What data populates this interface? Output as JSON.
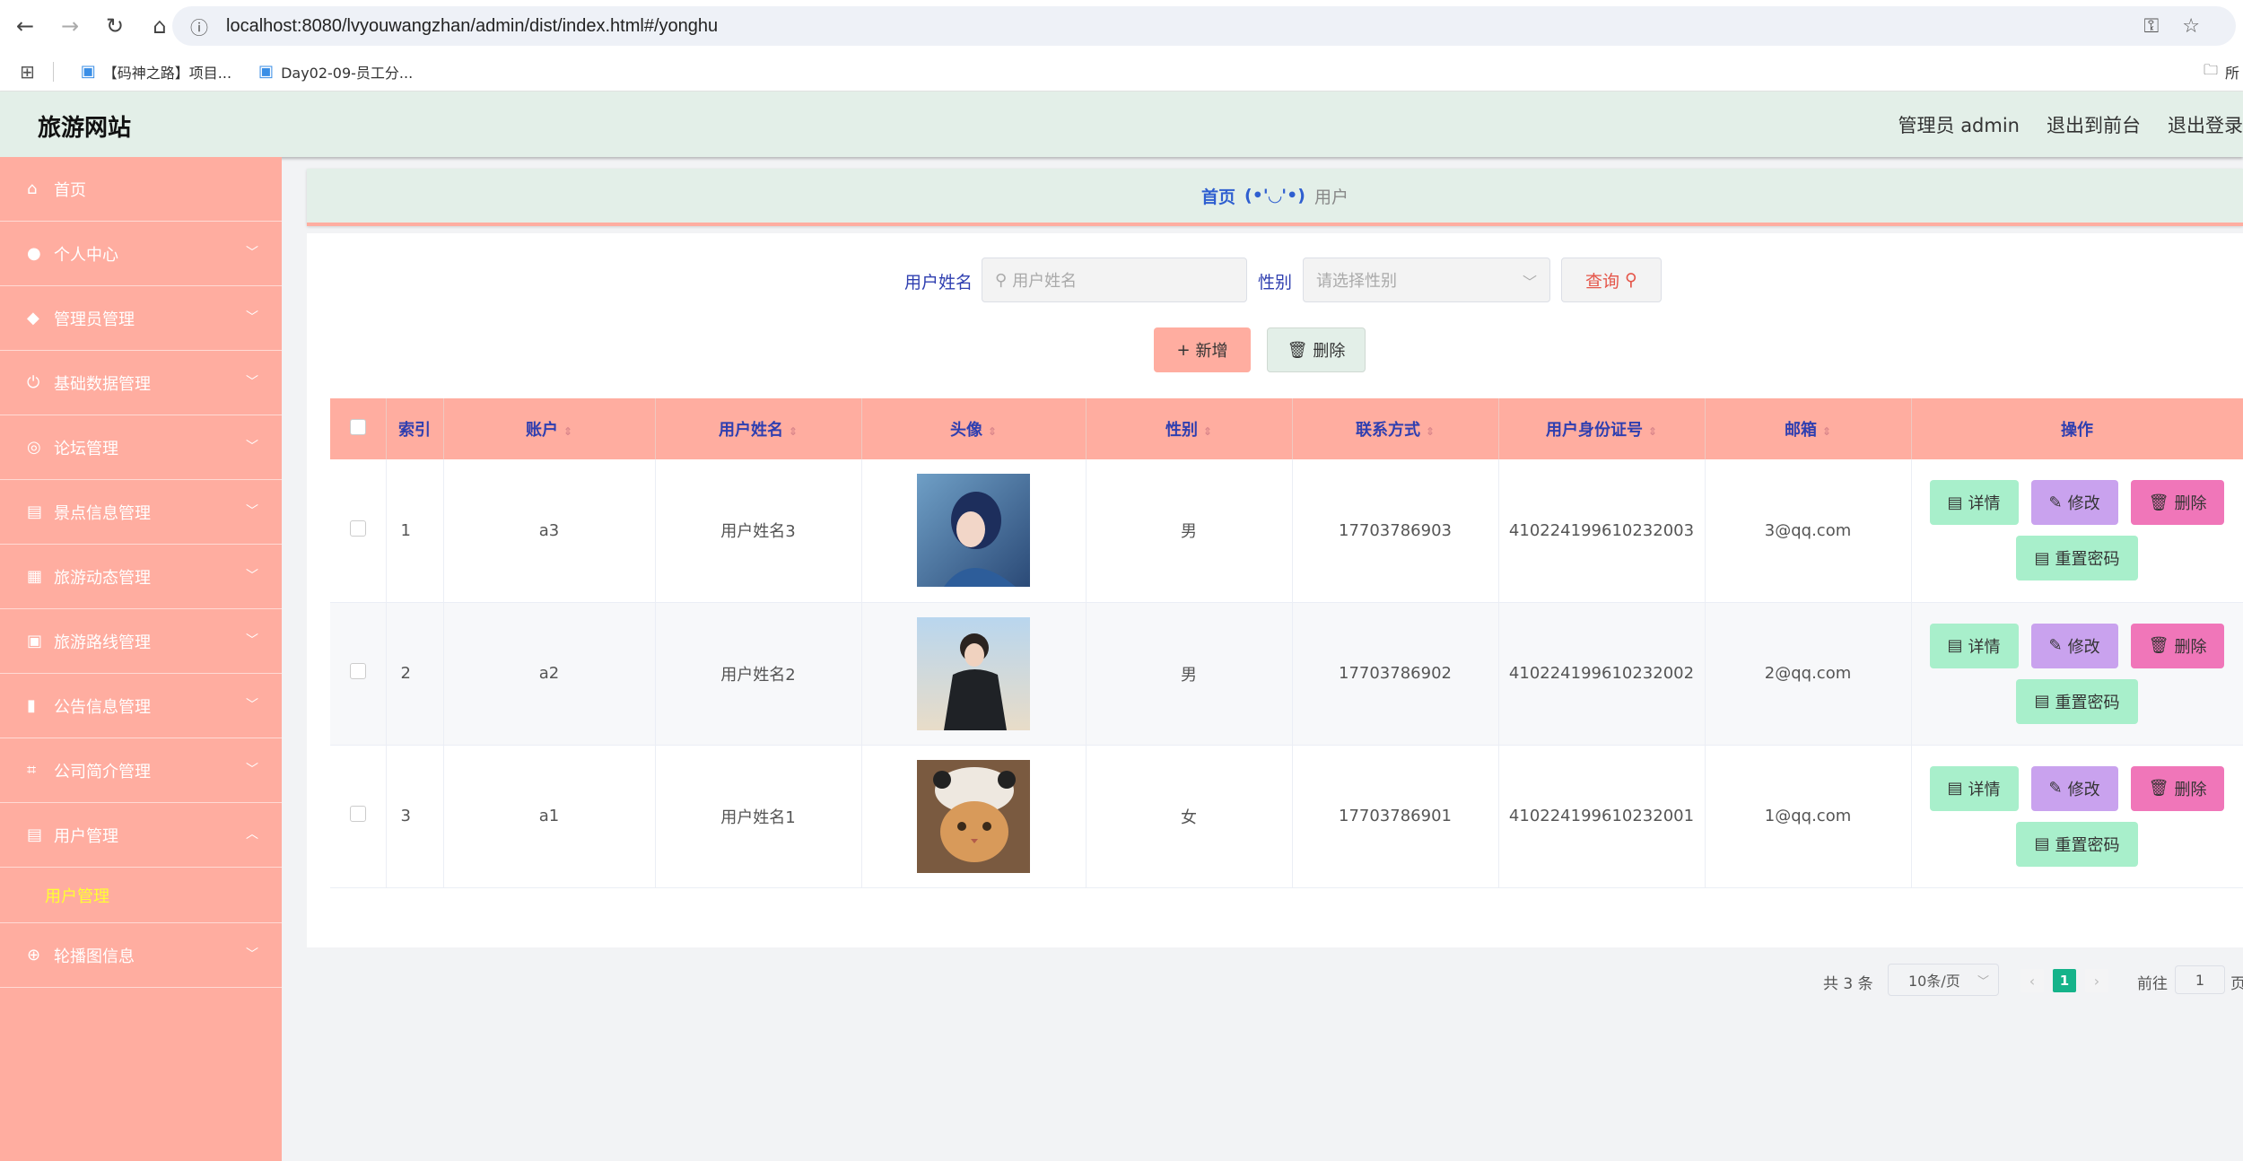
{
  "browser": {
    "url": "localhost:8080/lvyouwangzhan/admin/dist/index.html#/yonghu",
    "bookmarks": [
      "【码神之路】项目...",
      "Day02-09-员工分..."
    ],
    "bookmarks_right": "所"
  },
  "header": {
    "title": "旅游网站",
    "user": "管理员 admin",
    "to_front": "退出到前台",
    "logout": "退出登录"
  },
  "sidebar": {
    "items": [
      {
        "label": "首页",
        "icon": "home-icon"
      },
      {
        "label": "个人中心",
        "icon": "user-icon"
      },
      {
        "label": "管理员管理",
        "icon": "location-icon"
      },
      {
        "label": "基础数据管理",
        "icon": "power-icon"
      },
      {
        "label": "论坛管理",
        "icon": "compass-icon"
      },
      {
        "label": "景点信息管理",
        "icon": "document-icon"
      },
      {
        "label": "旅游动态管理",
        "icon": "grid-icon"
      },
      {
        "label": "旅游路线管理",
        "icon": "clipboard-icon"
      },
      {
        "label": "公告信息管理",
        "icon": "chart-icon"
      },
      {
        "label": "公司简介管理",
        "icon": "crop-icon"
      },
      {
        "label": "用户管理",
        "icon": "document-icon"
      },
      {
        "label": "轮播图信息",
        "icon": "basketball-icon"
      }
    ],
    "submenu": "用户管理"
  },
  "breadcrumb": {
    "home": "首页",
    "face": "(•'◡'•)",
    "current": "用户"
  },
  "search": {
    "name_label": "用户姓名",
    "name_placeholder": "用户姓名",
    "sex_label": "性别",
    "sex_placeholder": "请选择性别",
    "query_label": "查询"
  },
  "actions": {
    "add_label": "新增",
    "delete_label": "删除"
  },
  "table": {
    "headers": [
      "索引",
      "账户",
      "用户姓名",
      "头像",
      "性别",
      "联系方式",
      "用户身份证号",
      "邮箱",
      "操作"
    ],
    "rows": [
      {
        "index": "1",
        "account": "a3",
        "name": "用户姓名3",
        "sex": "男",
        "phone": "17703786903",
        "idcard": "410224199610232003",
        "email": "3@qq.com"
      },
      {
        "index": "2",
        "account": "a2",
        "name": "用户姓名2",
        "sex": "男",
        "phone": "17703786902",
        "idcard": "410224199610232002",
        "email": "2@qq.com"
      },
      {
        "index": "3",
        "account": "a1",
        "name": "用户姓名1",
        "sex": "女",
        "phone": "17703786901",
        "idcard": "410224199610232001",
        "email": "1@qq.com"
      }
    ],
    "op_labels": {
      "detail": "详情",
      "edit": "修改",
      "delete": "删除",
      "reset": "重置密码"
    }
  },
  "pagination": {
    "total": "共 3 条",
    "page_size": "10条/页",
    "current": "1",
    "goto": "前往",
    "goto_value": "1",
    "page_suffix": "页"
  },
  "colors": {
    "sidebar": "#ffada0",
    "header": "#e3efe8",
    "accent_text": "#2f3fb0",
    "pager_active": "#15b38a"
  }
}
